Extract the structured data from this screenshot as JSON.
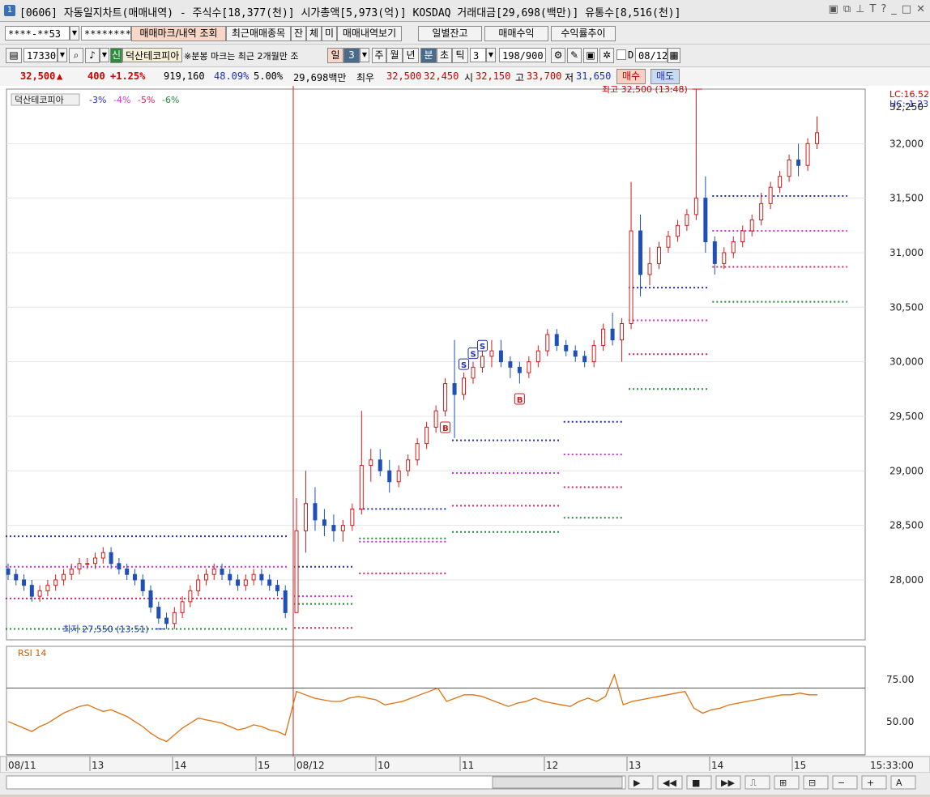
{
  "window": {
    "badge": "1",
    "title": "[0606] 자동일지차트(매매내역) - 주식수[18,377(천)] 시가총액[5,973(억)] KOSDAQ 거래대금[29,698(백만)] 유통수[8,516(천)]",
    "ctrl_icons": [
      "layout-icon",
      "copy-icon",
      "pin-icon",
      "font-icon",
      "help-icon",
      "minimize-icon",
      "maximize-icon",
      "close-icon"
    ],
    "ctrl_glyphs": [
      "▣",
      "⧉",
      "⊥",
      "T",
      "?",
      "_",
      "□",
      "✕"
    ]
  },
  "toolbar1": {
    "account": "****-**53",
    "password": "********",
    "buttons": [
      "매매마크/내역 조회",
      "최근매매종목",
      "잔",
      "체",
      "미",
      "매매내역보기"
    ],
    "right_buttons": [
      "일별잔고",
      "매매수익",
      "수익률추이"
    ]
  },
  "toolbar2": {
    "code": "17330",
    "new_badge": "신",
    "stock_name": "덕산테코피아",
    "note": "※분봉 마크는 최근 2개월만 조",
    "periods": [
      "일",
      "3",
      "주",
      "월",
      "년",
      "분",
      "초",
      "틱"
    ],
    "interval": "3",
    "count": "198/900",
    "d_label": "D",
    "date": "08/12"
  },
  "quote": {
    "price": "32,500",
    "arrow": "▲",
    "change": "400",
    "change_pct": "+1.25%",
    "volume": "919,160",
    "vol_ratio": "48.09%",
    "margin": "5.00%",
    "amount": "29,698백만",
    "label_choewoo": "최우",
    "ask": "32,500",
    "bid": "32,450",
    "open_label": "시",
    "open": "32,150",
    "high_label": "고",
    "high": "33,700",
    "low_label": "저",
    "low": "31,650",
    "buy_btn": "매수",
    "sell_btn": "매도"
  },
  "chart_data": {
    "type": "candlestick",
    "legend": {
      "name": "덕산테코피아",
      "items": [
        "-3%",
        "-4%",
        "-5%",
        "-6%"
      ],
      "colors": [
        "#1f2fb8",
        "#d62fd6",
        "#d6245a",
        "#1e8a3a"
      ]
    },
    "lc_label": "LC:16.52",
    "hc_label": "HC:-1.23",
    "ylim": [
      27450,
      32500
    ],
    "yticks": [
      32000,
      31500,
      31000,
      30500,
      30000,
      29500,
      29000,
      28500,
      28000
    ],
    "ytick_labels": [
      "32,000",
      "31,500",
      "31,000",
      "30,500",
      "30,000",
      "29,500",
      "29,000",
      "28,500",
      "28,000"
    ],
    "top_cut_label": "32,250",
    "annotations": {
      "high": "최고 32,500 (13:48)",
      "low": "최저 27,550 (13:51)"
    },
    "trade_marks": [
      {
        "label": "B",
        "type": "buy",
        "price": 29500
      },
      {
        "label": "S",
        "type": "sell",
        "price": 29870
      },
      {
        "label": "S",
        "type": "sell",
        "price": 29970
      },
      {
        "label": "S",
        "type": "sell",
        "price": 30040
      },
      {
        "label": "B",
        "type": "buy",
        "price": 29760
      }
    ],
    "sessions": [
      {
        "label": "08/11",
        "hours": [
          "13",
          "14",
          "15"
        ]
      },
      {
        "label": "08/12",
        "hours": [
          "10",
          "11",
          "12",
          "13",
          "14",
          "15"
        ]
      }
    ],
    "candles": [
      [
        28100,
        28150,
        28000,
        28050
      ],
      [
        28050,
        28100,
        27950,
        28000
      ],
      [
        28000,
        28050,
        27900,
        27950
      ],
      [
        27950,
        28000,
        27800,
        27850
      ],
      [
        27850,
        27950,
        27800,
        27900
      ],
      [
        27900,
        28000,
        27850,
        27950
      ],
      [
        27950,
        28050,
        27900,
        28000
      ],
      [
        28000,
        28100,
        27950,
        28050
      ],
      [
        28050,
        28150,
        28000,
        28100
      ],
      [
        28100,
        28200,
        28050,
        28150
      ],
      [
        28150,
        28200,
        28100,
        28150
      ],
      [
        28150,
        28250,
        28100,
        28200
      ],
      [
        28200,
        28300,
        28150,
        28250
      ],
      [
        28250,
        28300,
        28100,
        28150
      ],
      [
        28150,
        28200,
        28050,
        28100
      ],
      [
        28100,
        28150,
        28000,
        28050
      ],
      [
        28050,
        28100,
        27950,
        28000
      ],
      [
        28000,
        28050,
        27850,
        27900
      ],
      [
        27900,
        27950,
        27700,
        27750
      ],
      [
        27750,
        27800,
        27600,
        27650
      ],
      [
        27650,
        27700,
        27550,
        27600
      ],
      [
        27600,
        27750,
        27550,
        27700
      ],
      [
        27700,
        27850,
        27650,
        27800
      ],
      [
        27800,
        27950,
        27750,
        27900
      ],
      [
        27900,
        28050,
        27850,
        28000
      ],
      [
        28000,
        28100,
        27950,
        28050
      ],
      [
        28050,
        28150,
        28000,
        28100
      ],
      [
        28100,
        28150,
        28000,
        28050
      ],
      [
        28050,
        28100,
        27950,
        28000
      ],
      [
        28000,
        28050,
        27900,
        27950
      ],
      [
        27950,
        28050,
        27900,
        28000
      ],
      [
        28000,
        28100,
        27950,
        28050
      ],
      [
        28050,
        28100,
        27950,
        28000
      ],
      [
        28000,
        28050,
        27900,
        27950
      ],
      [
        27950,
        28000,
        27850,
        27900
      ],
      [
        27900,
        27950,
        27650,
        27700
      ],
      [
        27700,
        28750,
        27700,
        28450
      ],
      [
        28450,
        29000,
        28250,
        28700
      ],
      [
        28700,
        28850,
        28450,
        28550
      ],
      [
        28550,
        28650,
        28400,
        28500
      ],
      [
        28500,
        28600,
        28350,
        28450
      ],
      [
        28450,
        28550,
        28350,
        28500
      ],
      [
        28500,
        28700,
        28450,
        28650
      ],
      [
        28650,
        29550,
        28600,
        29050
      ],
      [
        29050,
        29200,
        28900,
        29100
      ],
      [
        29100,
        29200,
        28950,
        29000
      ],
      [
        29000,
        29100,
        28800,
        28900
      ],
      [
        28900,
        29050,
        28850,
        29000
      ],
      [
        29000,
        29150,
        28950,
        29100
      ],
      [
        29100,
        29300,
        29050,
        29250
      ],
      [
        29250,
        29450,
        29200,
        29400
      ],
      [
        29400,
        29600,
        29350,
        29550
      ],
      [
        29550,
        29850,
        29500,
        29800
      ],
      [
        29800,
        30200,
        29300,
        29700
      ],
      [
        29700,
        29900,
        29650,
        29850
      ],
      [
        29850,
        30000,
        29800,
        29950
      ],
      [
        29950,
        30100,
        29900,
        30050
      ],
      [
        30050,
        30200,
        29950,
        30100
      ],
      [
        30100,
        30200,
        29950,
        30000
      ],
      [
        30000,
        30050,
        29850,
        29950
      ],
      [
        29950,
        30000,
        29800,
        29900
      ],
      [
        29900,
        30050,
        29850,
        30000
      ],
      [
        30000,
        30150,
        29950,
        30100
      ],
      [
        30100,
        30300,
        30050,
        30250
      ],
      [
        30250,
        30300,
        30100,
        30150
      ],
      [
        30150,
        30200,
        30050,
        30100
      ],
      [
        30100,
        30150,
        30000,
        30050
      ],
      [
        30050,
        30100,
        29950,
        30000
      ],
      [
        30000,
        30200,
        29950,
        30150
      ],
      [
        30150,
        30350,
        30100,
        30300
      ],
      [
        30300,
        30450,
        30150,
        30200
      ],
      [
        30200,
        30400,
        30000,
        30350
      ],
      [
        30350,
        31650,
        30300,
        31200
      ],
      [
        31200,
        31350,
        30600,
        30800
      ],
      [
        30800,
        31050,
        30700,
        30900
      ],
      [
        30900,
        31100,
        30850,
        31050
      ],
      [
        31050,
        31200,
        31000,
        31150
      ],
      [
        31150,
        31300,
        31100,
        31250
      ],
      [
        31250,
        31400,
        31200,
        31350
      ],
      [
        31350,
        32500,
        31300,
        31500
      ],
      [
        31500,
        31700,
        31000,
        31100
      ],
      [
        31100,
        31150,
        30800,
        30900
      ],
      [
        30900,
        31050,
        30850,
        31000
      ],
      [
        31000,
        31150,
        30950,
        31100
      ],
      [
        31100,
        31250,
        31050,
        31200
      ],
      [
        31200,
        31350,
        31150,
        31300
      ],
      [
        31300,
        31550,
        31250,
        31450
      ],
      [
        31450,
        31650,
        31400,
        31600
      ],
      [
        31600,
        31750,
        31550,
        31700
      ],
      [
        31700,
        31900,
        31650,
        31850
      ],
      [
        31850,
        32000,
        31700,
        31800
      ],
      [
        31800,
        32050,
        31750,
        32000
      ],
      [
        32000,
        32250,
        31950,
        32100
      ]
    ],
    "band_lines": [
      {
        "series": "-3%",
        "segments": [
          [
            28400,
            0,
            35
          ],
          [
            28120,
            36,
            42
          ],
          [
            28650,
            43,
            52
          ],
          [
            29280,
            53,
            64
          ],
          [
            29450,
            65,
            71
          ],
          [
            30680,
            72,
            80
          ],
          [
            31520,
            81,
            95
          ]
        ]
      },
      {
        "series": "-4%",
        "segments": [
          [
            28120,
            0,
            35
          ],
          [
            27850,
            36,
            42
          ],
          [
            28350,
            43,
            52
          ],
          [
            28980,
            53,
            64
          ],
          [
            29150,
            65,
            71
          ],
          [
            30380,
            72,
            80
          ],
          [
            31200,
            81,
            95
          ]
        ]
      },
      {
        "series": "-5%",
        "segments": [
          [
            27830,
            0,
            35
          ],
          [
            27560,
            36,
            42
          ],
          [
            28060,
            43,
            52
          ],
          [
            28680,
            53,
            64
          ],
          [
            28850,
            65,
            71
          ],
          [
            30070,
            72,
            80
          ],
          [
            30870,
            81,
            95
          ]
        ]
      },
      {
        "series": "-6%",
        "segments": [
          [
            27550,
            0,
            35
          ],
          [
            27780,
            36,
            42
          ],
          [
            28380,
            43,
            52
          ],
          [
            28440,
            53,
            64
          ],
          [
            28570,
            65,
            71
          ],
          [
            29750,
            72,
            80
          ],
          [
            30550,
            81,
            95
          ]
        ]
      }
    ],
    "rsi": {
      "label": "RSI 14",
      "ytick_labels": [
        "75.00",
        "50.00"
      ],
      "ylim": [
        30,
        95
      ],
      "levels": [
        70,
        30
      ],
      "values": [
        50,
        48,
        46,
        44,
        47,
        49,
        52,
        55,
        57,
        59,
        60,
        58,
        56,
        57,
        55,
        53,
        50,
        47,
        43,
        40,
        38,
        42,
        46,
        49,
        52,
        51,
        50,
        49,
        47,
        45,
        46,
        48,
        47,
        45,
        44,
        42,
        68,
        66,
        64,
        63,
        62,
        62,
        64,
        65,
        64,
        63,
        60,
        61,
        62,
        64,
        66,
        68,
        70,
        62,
        64,
        66,
        66,
        65,
        63,
        61,
        59,
        61,
        62,
        64,
        62,
        61,
        60,
        59,
        62,
        64,
        62,
        65,
        78,
        60,
        62,
        63,
        64,
        65,
        66,
        67,
        68,
        58,
        55,
        57,
        58,
        60,
        61,
        62,
        63,
        64,
        65,
        66,
        66,
        67,
        66,
        66
      ]
    },
    "time_axis_right": "15:33:00"
  },
  "scrollbar": {
    "icons": [
      "play-icon",
      "step-back-icon",
      "stop-icon",
      "fast-forward-icon",
      "ruler-icon",
      "crosshair-icon",
      "grid-icon",
      "zoom-out-icon",
      "zoom-in-icon",
      "text-a-icon"
    ],
    "glyphs": [
      "▶",
      "◀◀",
      "■",
      "▶▶",
      "⎍",
      "⊞",
      "⊟",
      "−",
      "+",
      "A"
    ]
  }
}
